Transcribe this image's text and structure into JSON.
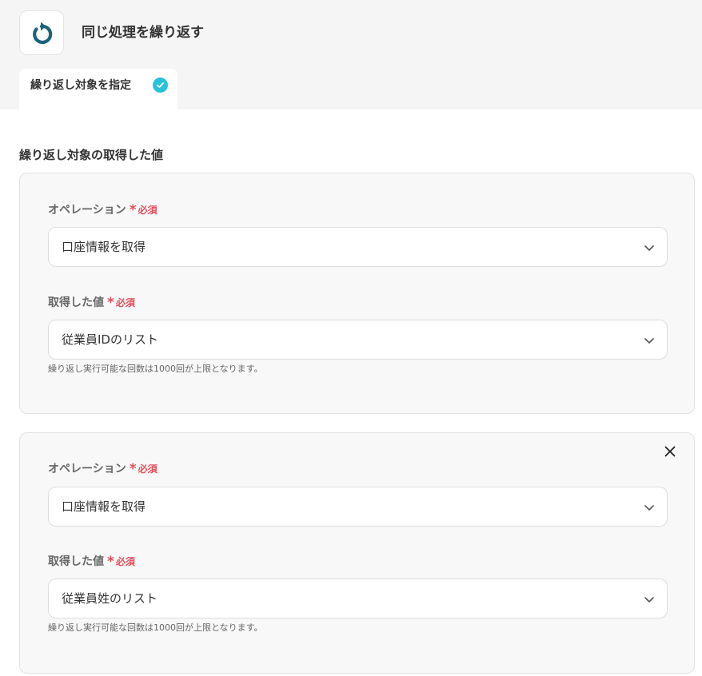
{
  "header": {
    "title": "同じ処理を繰り返す",
    "icon": "loop-arrow-icon",
    "icon_color": "#1a6478"
  },
  "tabs": [
    {
      "label": "繰り返し対象を指定",
      "status": "complete",
      "status_icon": "check-circle-icon",
      "status_color": "#27c2d9"
    }
  ],
  "section": {
    "title": "繰り返し対象の取得した値"
  },
  "cards": [
    {
      "operation_label": "オペレーション",
      "operation_required": "必須",
      "operation_value": "口座情報を取得",
      "value_label": "取得した値",
      "value_required": "必須",
      "value_value": "従業員IDのリスト",
      "hint": "繰り返し実行可能な回数は1000回が上限となります。"
    },
    {
      "operation_label": "オペレーション",
      "operation_required": "必須",
      "operation_value": "口座情報を取得",
      "value_label": "取得した値",
      "value_required": "必須",
      "value_value": "従業員姓のリスト",
      "hint": "繰り返し実行可能な回数は1000回が上限となります。",
      "removable": true
    }
  ],
  "colors": {
    "required": "#e54d5a",
    "accent": "#27c2d9"
  }
}
